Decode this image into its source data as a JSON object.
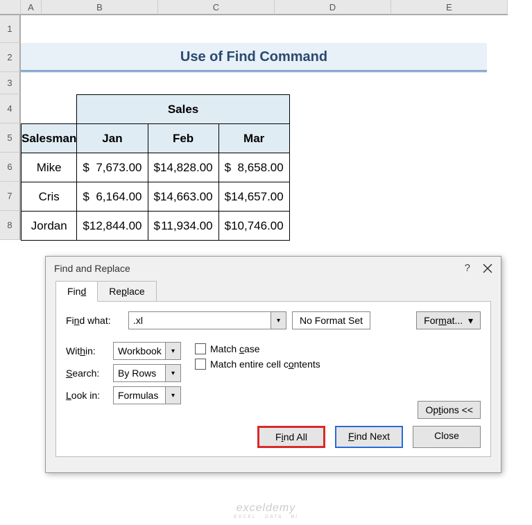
{
  "columns": [
    "A",
    "B",
    "C",
    "D",
    "E"
  ],
  "rows": [
    "1",
    "2",
    "3",
    "4",
    "5",
    "6",
    "7",
    "8"
  ],
  "title": "Use of Find Command",
  "table": {
    "salesHeader": "Sales",
    "salesmanHeader": "Salesman",
    "months": [
      "Jan",
      "Feb",
      "Mar"
    ],
    "data": [
      {
        "name": "Mike",
        "jan": "7,673.00",
        "feb": "14,828.00",
        "mar": "8,658.00"
      },
      {
        "name": "Cris",
        "jan": "6,164.00",
        "feb": "14,663.00",
        "mar": "14,657.00"
      },
      {
        "name": "Jordan",
        "jan": "12,844.00",
        "feb": "11,934.00",
        "mar": "10,746.00"
      }
    ],
    "currency": "$"
  },
  "dialog": {
    "title": "Find and Replace",
    "tabs": {
      "find": "Find",
      "replace": "Replace"
    },
    "findWhatLabel": "Find what:",
    "findWhatValue": ".xl",
    "noFormat": "No Format Set",
    "formatBtn": "Format...",
    "withinLabel": "Within:",
    "withinValue": "Workbook",
    "searchLabel": "Search:",
    "searchValue": "By Rows",
    "lookInLabel": "Look in:",
    "lookInValue": "Formulas",
    "matchCase": "Match case",
    "matchEntire": "Match entire cell contents",
    "optionsBtn": "Options <<",
    "findAll": "Find All",
    "findNext": "Find Next",
    "close": "Close"
  },
  "watermark": {
    "main": "exceldemy",
    "sub": "EXCEL · DATA · BI"
  }
}
